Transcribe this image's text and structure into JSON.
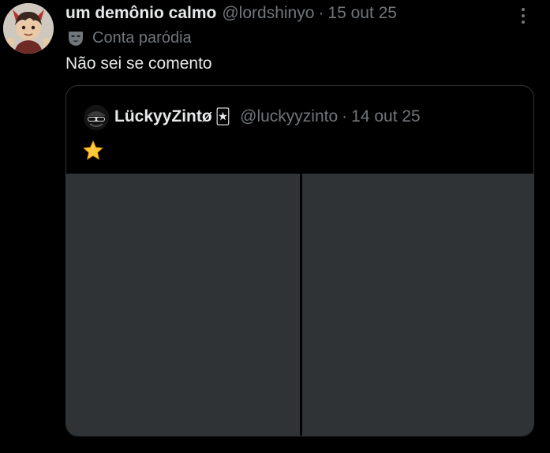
{
  "post": {
    "author_name": "um demônio calmo",
    "author_handle": "@lordshinyo",
    "separator": "·",
    "date": "15 out 25",
    "label": "Conta paródia",
    "text": "Não sei se comento"
  },
  "quoted": {
    "author_name": "LückyyZintø",
    "badge": "🃏",
    "author_handle": "@luckyyzinto",
    "separator": "·",
    "date": "14 out 25",
    "text": "⭐"
  },
  "colors": {
    "background": "#000000",
    "primary_text": "#e7e9ea",
    "secondary_text": "#71767b",
    "border": "#2f3336",
    "media_placeholder": "#2f3336",
    "star": "#ffc83d"
  },
  "icons": {
    "more": "more-icon",
    "parody": "mask-icon",
    "star": "star-icon"
  }
}
